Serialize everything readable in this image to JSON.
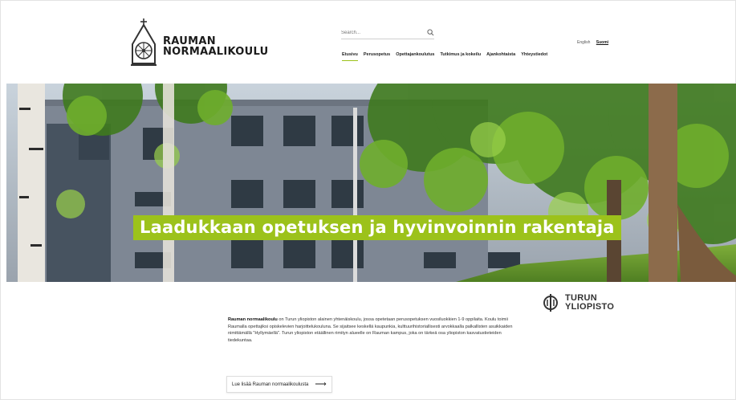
{
  "header": {
    "logo_line1": "RAUMAN",
    "logo_line2": "NORMAALIKOULU",
    "search_placeholder": "Search...",
    "languages": [
      "English",
      "Suomi"
    ],
    "active_language": "Suomi",
    "nav": [
      "Etusivu",
      "Perusopetus",
      "Opettajankoulutus",
      "Tutkimus ja kokeilu",
      "Ajankohtaista",
      "Yhteystiedot"
    ],
    "active_nav": "Etusivu"
  },
  "hero": {
    "headline": "Laadukkaan opetuksen ja hyvinvoinnin rakentaja"
  },
  "partner": {
    "line1": "TURUN",
    "line2": "YLIOPISTO"
  },
  "intro": {
    "lead": "Rauman normaalikoulu",
    "body": " on Turun yliopiston alainen yhtenäiskoulu, jossa opetetaan perusopetuksen vuosiluokkien 1-9 oppilaita. Koulu toimii Raumalla opettajiksi opiskelevien harjoittelukouluna. Se sijaitsee keskellä kaupunkia, kulttuurihistoriallisesti arvokkaalla palkallisten asuikkaiden nimittämällä \"Hyllymäellä\". Turun yliopiston etäällinen rimityn alueelle on Rauman kampus, joka on tärkeä osa yliopiston kasvatustieteiden tiedekuntaa."
  },
  "cta": {
    "label": "Lue lisää Rauman normaalikoulusta",
    "arrow": "⟶"
  },
  "colors": {
    "accent": "#9cc21b",
    "text": "#222222"
  },
  "icons": {
    "search": "search-icon",
    "logo": "school-emblem-icon",
    "partner": "turun-yliopisto-emblem-icon"
  }
}
